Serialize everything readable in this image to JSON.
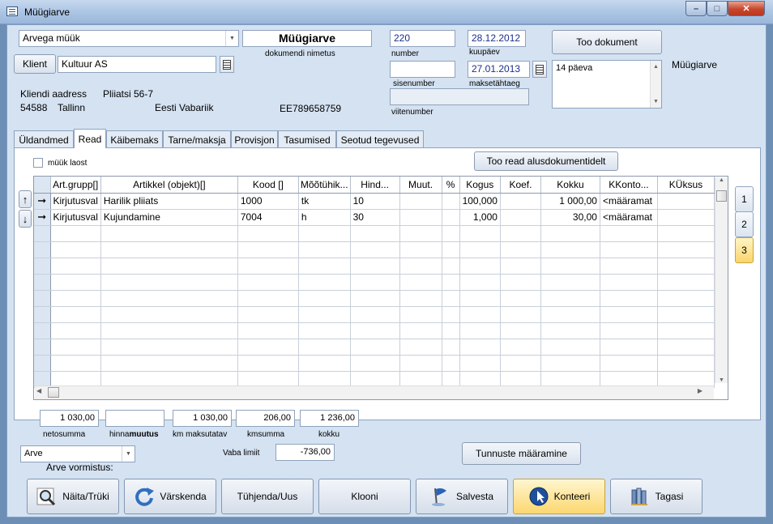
{
  "window": {
    "title": "Müügiarve"
  },
  "header": {
    "doc_type_value": "Arvega müük",
    "doc_name": "Müügiarve",
    "doc_name_label": "dokumendi nimetus",
    "number_value": "220",
    "number_label": "number",
    "date_value": "28.12.2012",
    "date_label": "kuupäev",
    "sisenumber_value": "",
    "sisenumber_label": "sisenumber",
    "due_value": "27.01.2013",
    "due_label": "maksetähtaeg",
    "viitenumber_value": "",
    "viitenumber_label": "viitenumber",
    "too_dokument_label": "Too dokument",
    "notes_value": "14 päeva",
    "side_label": "Müügiarve",
    "klient_button": "Klient",
    "client_value": "Kultuur AS",
    "address_label": "Kliendi aadress",
    "address_street": "Pliiatsi 56-7",
    "address_zip": "54588",
    "address_city": "Tallinn",
    "address_country": "Eesti Vabariik",
    "vat_code": "EE789658759"
  },
  "tabs": [
    {
      "label": "Üldandmed"
    },
    {
      "label": "Read"
    },
    {
      "label": "Käibemaks"
    },
    {
      "label": "Tarne/maksja"
    },
    {
      "label": "Provisjon"
    },
    {
      "label": "Tasumised"
    },
    {
      "label": "Seotud tegevused"
    }
  ],
  "rows_tab": {
    "checkbox_label": "müük laost",
    "too_read_label": "Too read alusdokumentidelt",
    "columns": [
      "Art.grupp[]",
      "Artikkel (objekt)[]",
      "Kood []",
      "Mõõtühik...",
      "Hind...",
      "Muut.",
      "%",
      "Kogus",
      "Koef.",
      "Kokku",
      "KKonto...",
      "KÜksus"
    ],
    "rows": [
      [
        "Kirjutusval",
        "Harilik pliiats",
        "1000",
        "tk",
        "10",
        "",
        "",
        "100,000",
        "",
        "1 000,00",
        "<määramat",
        ""
      ],
      [
        "Kirjutusval",
        "Kujundamine",
        "7004",
        "h",
        "30",
        "",
        "",
        "1,000",
        "",
        "30,00",
        "<määramat",
        ""
      ]
    ],
    "pages": [
      "1",
      "2",
      "3"
    ],
    "up_arrow": "↑",
    "down_arrow": "↓",
    "row_arrow": "➞"
  },
  "totals": {
    "netosumma_value": "1 030,00",
    "netosumma_label": "netosumma",
    "hinnamuutus_value": "",
    "hinnamuutus_label_a": "hinna",
    "hinnamuutus_label_b": "muutus",
    "km_maksutatav_value": "1 030,00",
    "km_maksutatav_label": "km maksutatav",
    "kmsumma_value": "206,00",
    "kmsumma_label": "kmsumma",
    "kokku_value": "1 236,00",
    "kokku_label": "kokku"
  },
  "bottom": {
    "form_value": "Arve",
    "form_label": "Arve vormistus:",
    "vaba_limiit_label": "Vaba limiit",
    "vaba_limiit_value": "-736,00",
    "tunnuste_label": "Tunnuste määramine"
  },
  "buttons": [
    {
      "label": "Näita/Trüki",
      "icon": "magnifier-icon"
    },
    {
      "label": "Värskenda",
      "icon": "refresh-icon"
    },
    {
      "label": "Tühjenda/Uus",
      "icon": ""
    },
    {
      "label": "Klooni",
      "icon": ""
    },
    {
      "label": "Salvesta",
      "icon": "flag-icon"
    },
    {
      "label": "Konteeri",
      "icon": "cursor-globe-icon"
    },
    {
      "label": "Tagasi",
      "icon": "books-icon"
    }
  ],
  "colors": {
    "panel": "#d4e2f2",
    "accent": "#fbd76f",
    "value_blue": "#1b2f8c"
  }
}
